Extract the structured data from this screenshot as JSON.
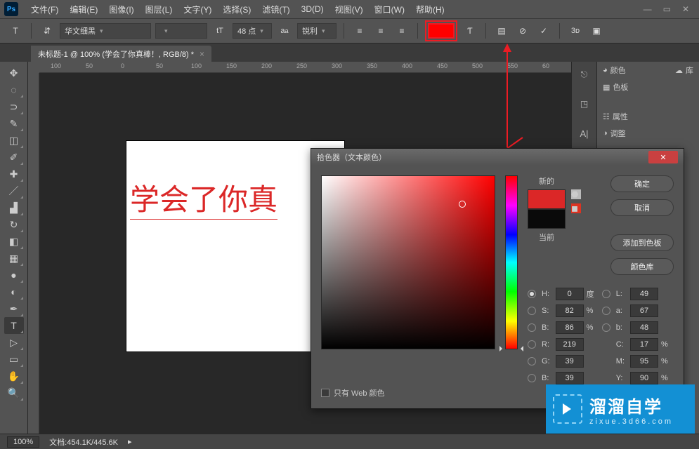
{
  "menubar": {
    "items": [
      "文件(F)",
      "编辑(E)",
      "图像(I)",
      "图层(L)",
      "文字(Y)",
      "选择(S)",
      "滤镜(T)",
      "3D(D)",
      "视图(V)",
      "窗口(W)",
      "帮助(H)"
    ]
  },
  "optbar": {
    "font": "华文细黑",
    "style": "",
    "size": "48 点",
    "aa": "锐利",
    "color": "#ff0000"
  },
  "tab": {
    "title": "未标题-1 @ 100% (学会了你真棒！, RGB/8) *"
  },
  "ruler": {
    "marks": [
      "100",
      "50",
      "0",
      "50",
      "100",
      "150",
      "200",
      "250",
      "300",
      "350",
      "400",
      "450",
      "500",
      "550",
      "60"
    ]
  },
  "canvas": {
    "text": "学会了你真"
  },
  "panels": {
    "color": "颜色",
    "swatches": "色板",
    "properties": "属性",
    "adjust": "调整",
    "library": "库"
  },
  "picker": {
    "title": "拾色器（文本颜色）",
    "ok": "确定",
    "cancel": "取消",
    "add": "添加到色板",
    "lib": "颜色库",
    "new": "新的",
    "current": "当前",
    "H": "0",
    "S": "82",
    "B": "86",
    "R": "219",
    "G": "39",
    "B2": "39",
    "L": "49",
    "a": "67",
    "b": "48",
    "C": "17",
    "M": "95",
    "Y": "90",
    "deg": "度",
    "webonly": "只有 Web 颜色"
  },
  "status": {
    "zoom": "100%",
    "doc": "文档:454.1K/445.6K"
  },
  "watermark": {
    "big": "溜溜自学",
    "small": "zixue.3d66.com"
  }
}
